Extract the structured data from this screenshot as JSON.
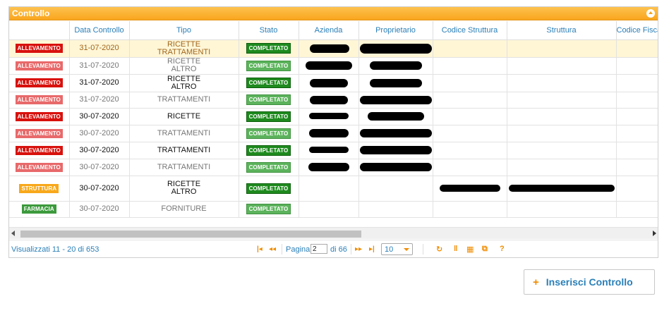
{
  "panel": {
    "title": "Controllo"
  },
  "columns": [
    "",
    "Data Controllo",
    "Tipo",
    "Stato",
    "Azienda",
    "Proprietario",
    "Codice Struttura",
    "Struttura",
    "Codice Fiscale"
  ],
  "rows": [
    {
      "badge": "ALLEVAMENTO",
      "badge_color": "#d8110d",
      "date": "31-07-2020",
      "tipo": [
        "RICETTE",
        "TRATTAMENTI"
      ],
      "stato": "COMPLETATO",
      "selected": true
    },
    {
      "badge": "ALLEVAMENTO",
      "badge_color": "#e8696a",
      "date": "31-07-2020",
      "tipo": [
        "RICETTE",
        "ALTRO"
      ],
      "stato": "COMPLETATO"
    },
    {
      "badge": "ALLEVAMENTO",
      "badge_color": "#d8110d",
      "date": "31-07-2020",
      "tipo": [
        "RICETTE",
        "ALTRO"
      ],
      "stato": "COMPLETATO"
    },
    {
      "badge": "ALLEVAMENTO",
      "badge_color": "#e8696a",
      "date": "31-07-2020",
      "tipo": [
        "TRATTAMENTI"
      ],
      "stato": "COMPLETATO"
    },
    {
      "badge": "ALLEVAMENTO",
      "badge_color": "#d8110d",
      "date": "30-07-2020",
      "tipo": [
        "RICETTE"
      ],
      "stato": "COMPLETATO"
    },
    {
      "badge": "ALLEVAMENTO",
      "badge_color": "#e8696a",
      "date": "30-07-2020",
      "tipo": [
        "TRATTAMENTI"
      ],
      "stato": "COMPLETATO"
    },
    {
      "badge": "ALLEVAMENTO",
      "badge_color": "#d8110d",
      "date": "30-07-2020",
      "tipo": [
        "TRATTAMENTI"
      ],
      "stato": "COMPLETATO"
    },
    {
      "badge": "ALLEVAMENTO",
      "badge_color": "#e8696a",
      "date": "30-07-2020",
      "tipo": [
        "TRATTAMENTI"
      ],
      "stato": "COMPLETATO"
    },
    {
      "badge": "STRUTTURA",
      "badge_color": "#f8a81a",
      "date": "30-07-2020",
      "tipo": [
        "RICETTE",
        "ALTRO"
      ],
      "stato": "COMPLETATO"
    },
    {
      "badge": "FARMACIA",
      "badge_color": "#3c9a3c",
      "date": "30-07-2020",
      "tipo": [
        "FORNITURE"
      ],
      "stato": "COMPLETATO"
    }
  ],
  "pager": {
    "info": "Visualizzati 11 - 20 di 653",
    "page_label": "Pagina",
    "page_value": "2",
    "page_total": "di 66",
    "page_size": "10"
  },
  "insert_button": {
    "label": "Inserisci Controllo"
  },
  "colors": {
    "accent_orange": "#f9a51d",
    "link_blue": "#2a7fb8",
    "status_green": "#1e8a1e"
  }
}
